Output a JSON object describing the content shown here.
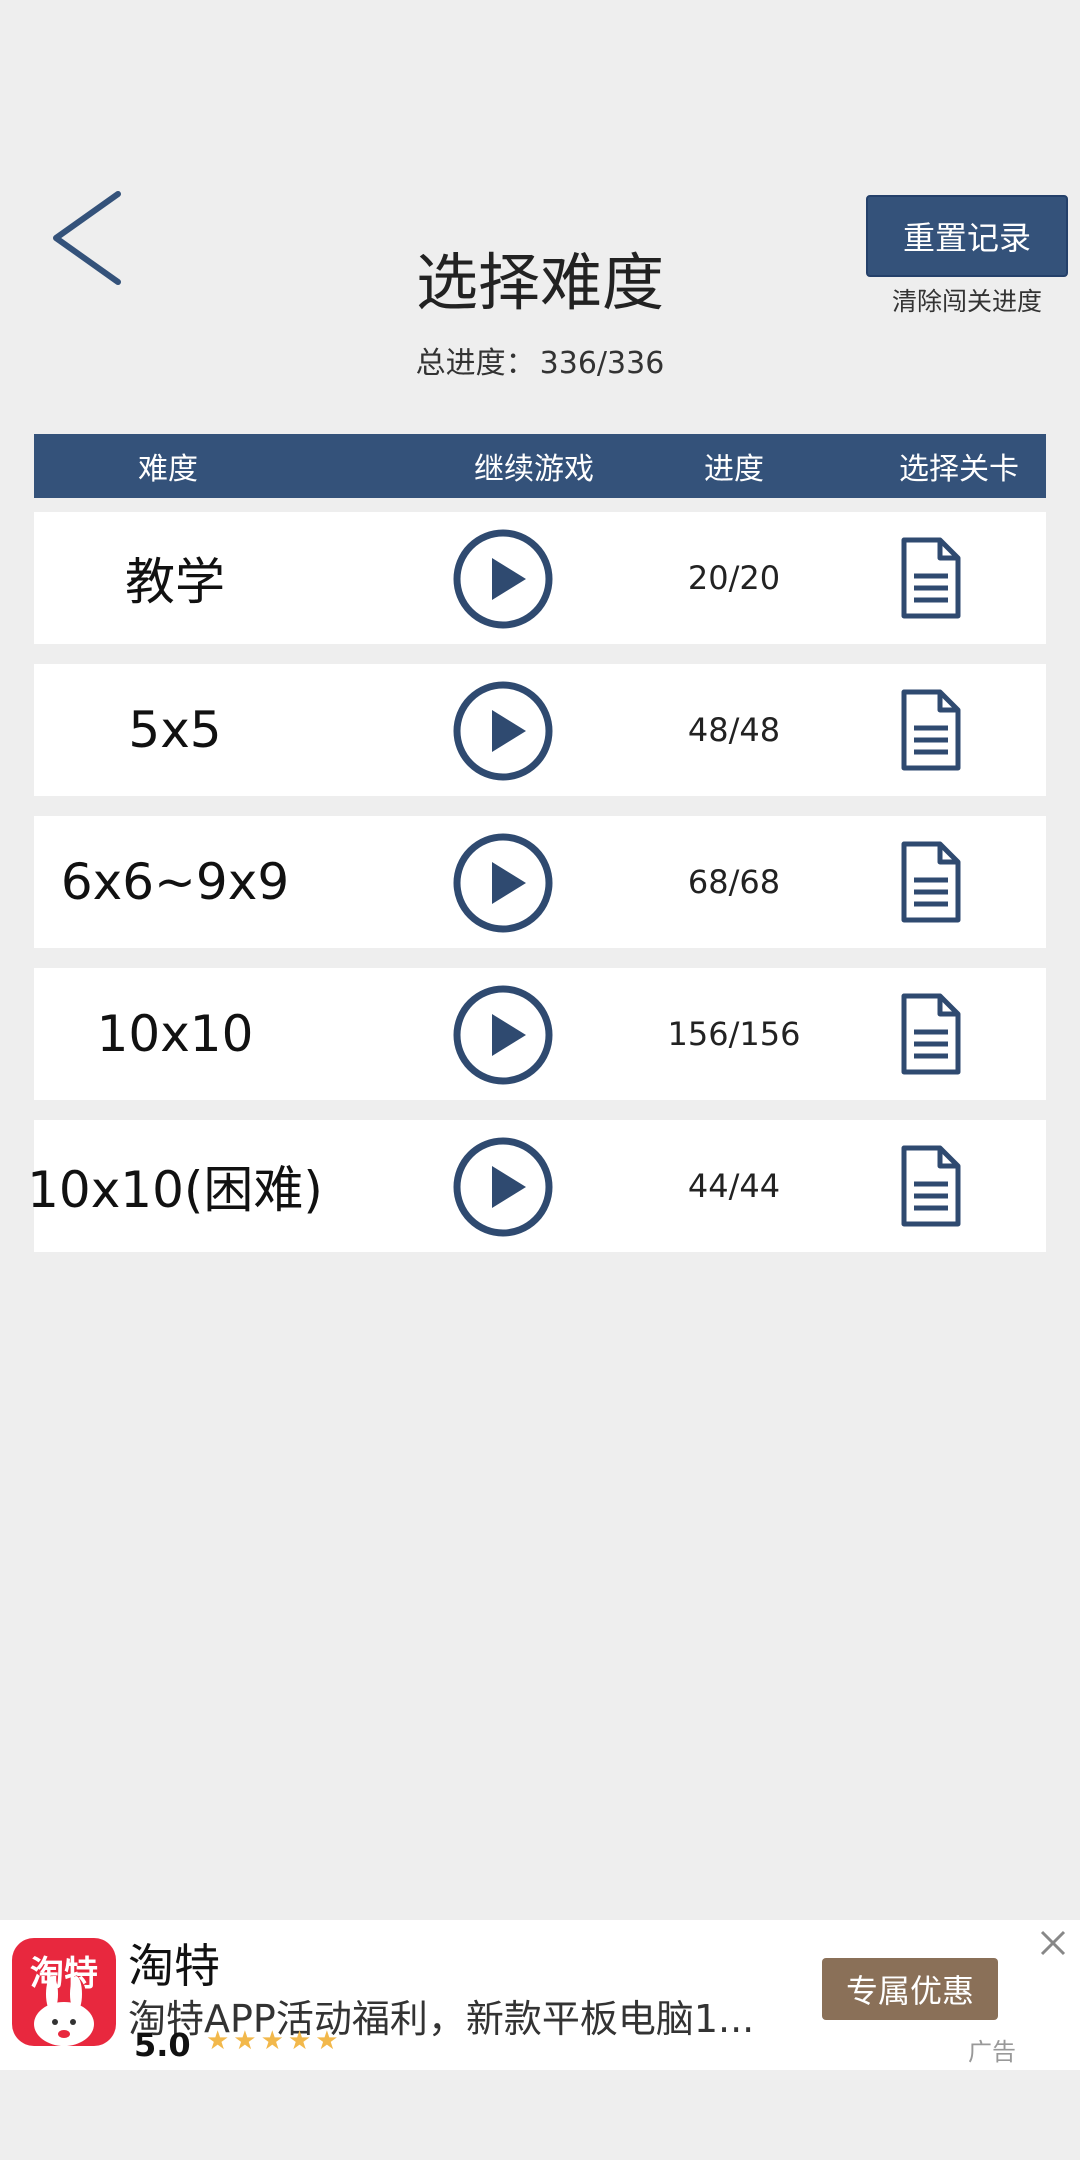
{
  "header": {
    "title": "选择难度",
    "total_label": "总进度：",
    "total_value": "336/336",
    "reset_button": "重置记录",
    "reset_sub": "清除闯关进度"
  },
  "table": {
    "headers": [
      "难度",
      "继续游戏",
      "进度",
      "选择关卡"
    ],
    "rows": [
      {
        "name": "教学",
        "progress": "20/20"
      },
      {
        "name": "5x5",
        "progress": "48/48"
      },
      {
        "name": "6x6~9x9",
        "progress": "68/68"
      },
      {
        "name": "10x10",
        "progress": "156/156"
      },
      {
        "name": "10x10(困难)",
        "progress": "44/44"
      }
    ]
  },
  "ad": {
    "logo_text": "淘特",
    "title": "淘特",
    "description": "淘特APP活动福利，新款平板电脑1...",
    "rating": "5.0",
    "stars": "★★★★★",
    "button": "专属优惠",
    "label": "广告"
  },
  "colors": {
    "primary": "#34527a",
    "background": "#eeeeee",
    "ad_logo": "#e8283e"
  }
}
